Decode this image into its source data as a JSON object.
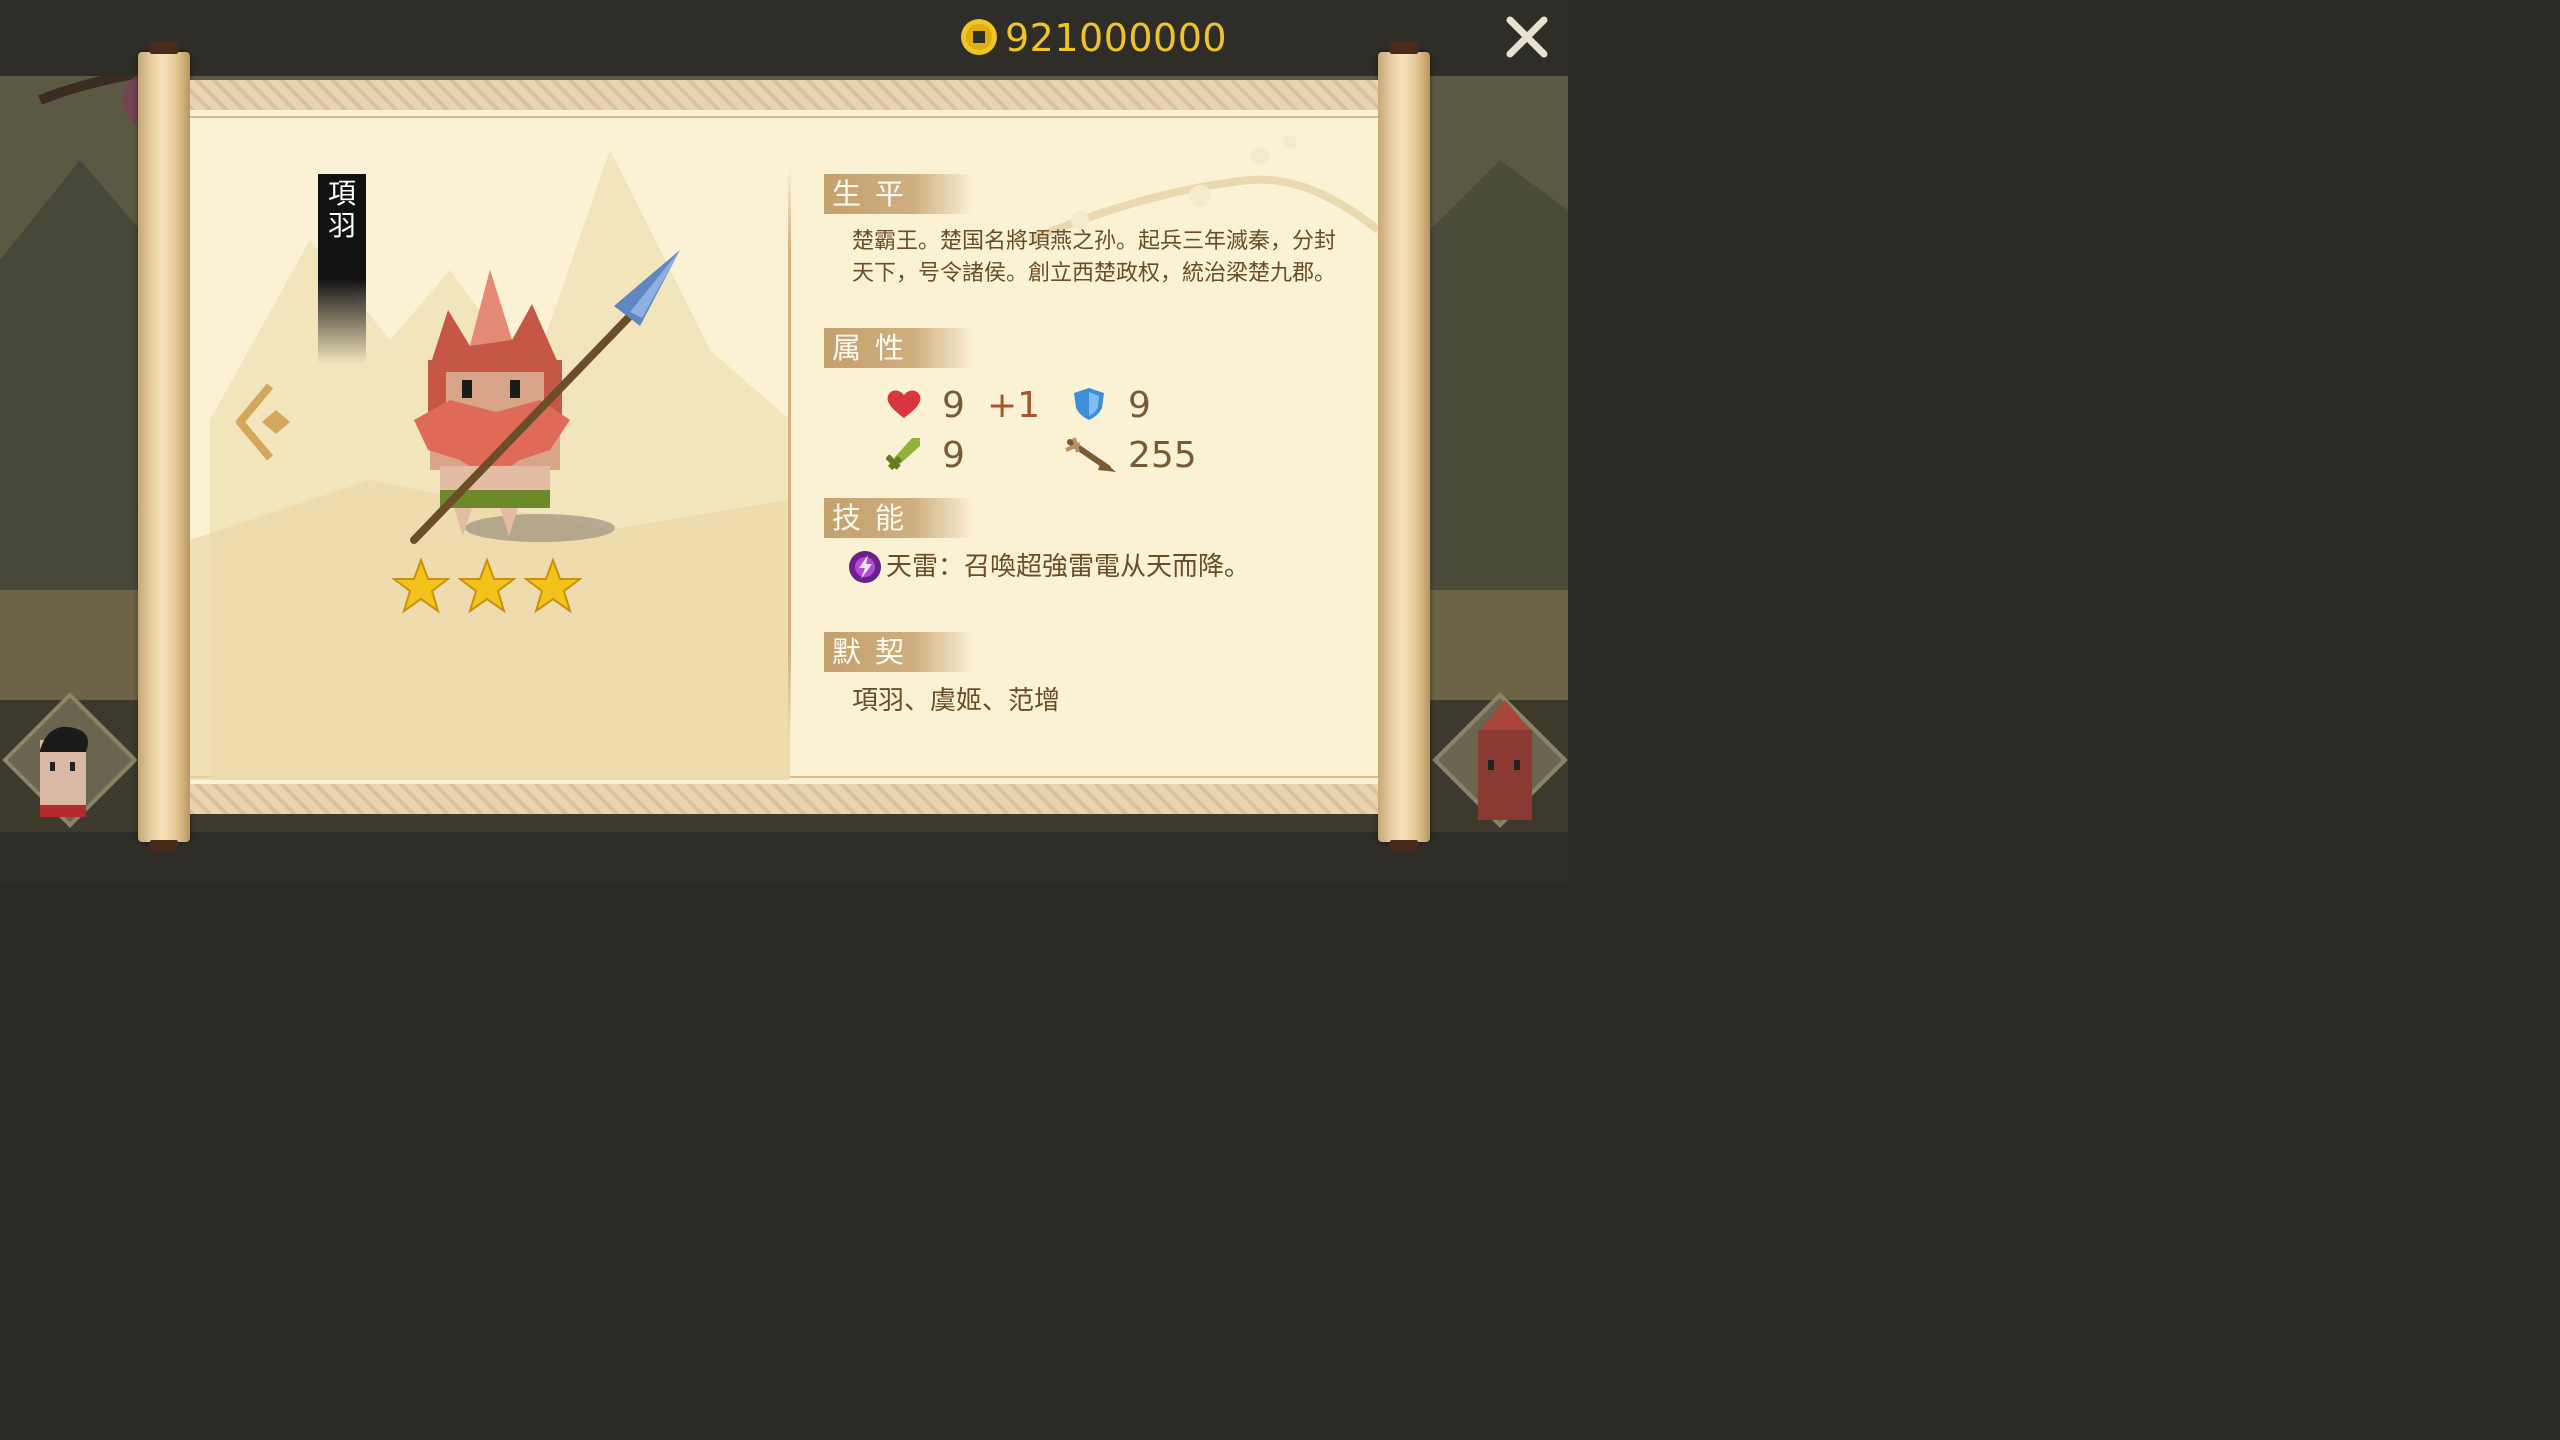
{
  "header": {
    "coins": "921000000",
    "coin_icon": "coin-icon",
    "close_icon": "close-icon"
  },
  "hero": {
    "name": "項\n羽",
    "stars": 3,
    "prev_icon": "chevron-left-icon"
  },
  "sections": {
    "bio_title": "生平",
    "bio_text": "楚霸王。楚国名將項燕之孙。起兵三年滅秦，分封天下，号令諸侯。創立西楚政权，統治梁楚九郡。",
    "attr_title": "属性",
    "skill_title": "技能",
    "bond_title": "默契"
  },
  "stats": {
    "health": "9",
    "health_bonus": "+1",
    "defense": "9",
    "attack": "9",
    "range": "255"
  },
  "skill": {
    "text": "天雷：召喚超強雷電从天而降。",
    "icon": "thunder-skill-icon"
  },
  "bond": {
    "text": "項羽、虞姬、范增"
  },
  "colors": {
    "coin": "#f1c425",
    "paper": "#fbf2d6",
    "section": "#c4a06d",
    "text": "#6b4c26",
    "heart": "#d8353d",
    "shield": "#3d8fd6",
    "sword": "#8db33a"
  }
}
